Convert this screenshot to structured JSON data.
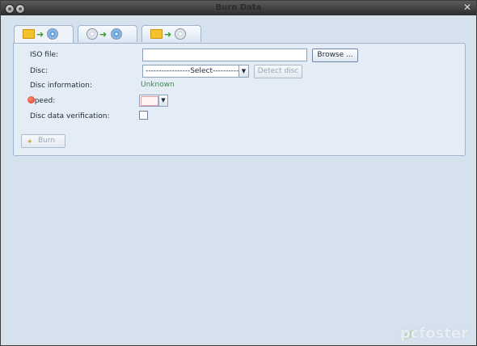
{
  "window": {
    "title": "Burn Data"
  },
  "tabs": [
    {
      "name": "folder-to-disc"
    },
    {
      "name": "disc-to-disc"
    },
    {
      "name": "folder-to-image"
    }
  ],
  "form": {
    "iso_label": "ISO file:",
    "iso_value": "",
    "browse_label": "Browse ...",
    "disc_label": "Disc:",
    "disc_selected": "-----------------Select-----------------",
    "detect_label": "Detect disc",
    "disc_info_label": "Disc information:",
    "disc_info_value": "Unknown",
    "speed_label": "Speed:",
    "verify_label": "Disc data verification:",
    "burn_label": "Burn"
  },
  "watermark": {
    "text": "pcfoster"
  },
  "colors": {
    "accent": "#3c8e52",
    "panel": "#e4ecf6",
    "window_bg": "#d6e1ee"
  }
}
